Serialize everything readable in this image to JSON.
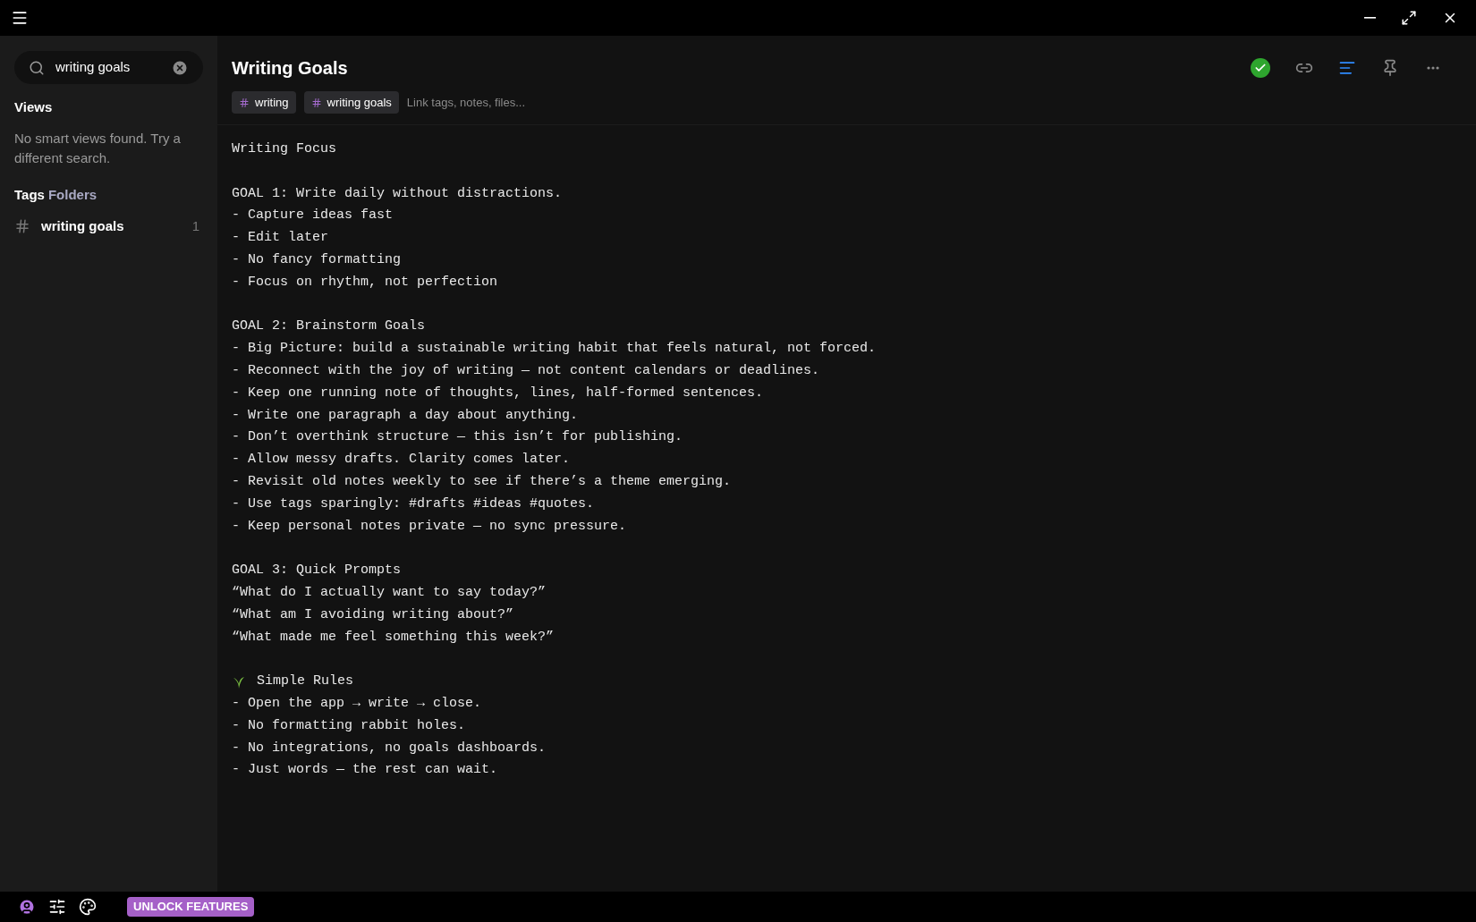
{
  "search": {
    "value": "writing goals"
  },
  "views": {
    "heading": "Views",
    "empty_message": "No smart views found. Try a different search."
  },
  "nav_tabs": [
    {
      "label": "Tags",
      "selected": true
    },
    {
      "label": "Folders",
      "selected": false
    }
  ],
  "tag_list": [
    {
      "label": "writing goals",
      "count": "1"
    }
  ],
  "note": {
    "title": "Writing Goals",
    "saved": true,
    "tags": [
      "writing",
      "writing goals"
    ],
    "link_placeholder": "Link tags, notes, files...",
    "toolbar": [
      {
        "kind": "link",
        "active": false
      },
      {
        "kind": "editor",
        "active": true
      },
      {
        "kind": "pin",
        "active": false
      },
      {
        "kind": "more",
        "active": false
      }
    ],
    "blocks": [
      {
        "has_icon": false,
        "lines": [
          "Writing Focus"
        ]
      },
      {
        "has_icon": false,
        "lines": [
          "GOAL 1: Write daily without distractions.",
          "- Capture ideas fast",
          "- Edit later",
          "- No fancy formatting",
          "- Focus on rhythm, not perfection"
        ]
      },
      {
        "has_icon": false,
        "lines": [
          "GOAL 2: Brainstorm Goals",
          "- Big Picture: build a sustainable writing habit that feels natural, not forced.",
          "- Reconnect with the joy of writing — not content calendars or deadlines.",
          "- Keep one running note of thoughts, lines, half-formed sentences.",
          "- Write one paragraph a day about anything.",
          "- Don’t overthink structure — this isn’t for publishing.",
          "- Allow messy drafts. Clarity comes later.",
          "- Revisit old notes weekly to see if there’s a theme emerging.",
          "- Use tags sparingly: #drafts #ideas #quotes.",
          "- Keep personal notes private — no sync pressure."
        ]
      },
      {
        "has_icon": false,
        "lines": [
          "GOAL 3: Quick Prompts",
          "“What do I actually want to say today?”",
          "“What am I avoiding writing about?”",
          "“What made me feel something this week?”"
        ]
      },
      {
        "has_icon": true,
        "lines": [
          "Simple Rules",
          "- Open the app → write → close.",
          "- No formatting rabbit holes.",
          "- No integrations, no goals dashboards.",
          "- Just words — the rest can wait."
        ]
      }
    ]
  },
  "footer": {
    "unlock_label": "UNLOCK FEATURES"
  }
}
